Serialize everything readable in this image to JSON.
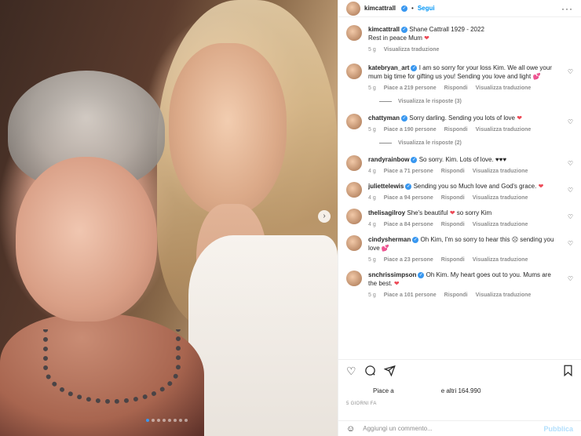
{
  "header": {
    "username": "kimcattrall",
    "separator": "•",
    "follow_label": "Segui",
    "more_icon": "more-horizontal-icon"
  },
  "caption": {
    "username": "kimcattrall",
    "text": "Shane Cattrall 1929 - 2022",
    "text2": "Rest in peace Mum",
    "emoji": "❤",
    "age": "5 g",
    "translate": "Visualizza traduzione"
  },
  "comments": [
    {
      "username": "katebryan_art",
      "verified": true,
      "text": "I am so sorry for your loss Kim. We all owe your mum big time for gifting us you! Sending you love and light",
      "emoji": "💕",
      "emoji_class": "pink",
      "age": "5 g",
      "likes": "Piace a 219 persone",
      "reply": "Rispondi",
      "translate": "Visualizza traduzione",
      "replies": "Visualizza le risposte (3)"
    },
    {
      "username": "chattyman",
      "verified": true,
      "text": "Sorry darling. Sending you lots of love",
      "emoji": "❤",
      "emoji_class": "red",
      "age": "5 g",
      "likes": "Piace a 190 persone",
      "reply": "Rispondi",
      "translate": "Visualizza traduzione",
      "replies": "Visualizza le risposte (2)"
    },
    {
      "username": "randyrainbow",
      "verified": true,
      "text": "So sorry. Kim. Lots of love.",
      "emoji": "♥♥♥",
      "emoji_class": "",
      "age": "4 g",
      "likes": "Piace a 71 persone",
      "reply": "Rispondi",
      "translate": "Visualizza traduzione",
      "replies": ""
    },
    {
      "username": "juliettelewis",
      "verified": true,
      "text": "Sending you so Much love and God's grace.",
      "emoji": "❤",
      "emoji_class": "red",
      "age": "4 g",
      "likes": "Piace a 94 persone",
      "reply": "Rispondi",
      "translate": "Visualizza traduzione",
      "replies": ""
    },
    {
      "username": "thelisagilroy",
      "verified": false,
      "text": "She's beautiful",
      "emoji": "❤",
      "emoji_class": "red",
      "text_after": "so sorry Kim",
      "age": "4 g",
      "likes": "Piace a 84 persone",
      "reply": "Rispondi",
      "translate": "Visualizza traduzione",
      "replies": ""
    },
    {
      "username": "cindysherman",
      "verified": true,
      "text": "Oh Kim, I'm so sorry to hear this ☹ sending you love",
      "emoji": "💕",
      "emoji_class": "pink",
      "age": "5 g",
      "likes": "Piace a 23 persone",
      "reply": "Rispondi",
      "translate": "Visualizza traduzione",
      "replies": ""
    },
    {
      "username": "snchrissimpson",
      "verified": true,
      "text": "Oh Kim. My heart goes out to you. Mums are the best.",
      "emoji": "❤",
      "emoji_class": "red",
      "age": "5 g",
      "likes": "Piace a 101 persone",
      "reply": "Rispondi",
      "translate": "Visualizza traduzione",
      "replies": ""
    }
  ],
  "actions": {
    "like_icon": "heart-outline-icon",
    "comment_icon": "comment-icon",
    "share_icon": "share-icon",
    "save_icon": "bookmark-icon"
  },
  "likes": {
    "prefix": "Piace a",
    "suffix": "e altri 164.990"
  },
  "post_age": "5 GIORNI FA",
  "add_comment": {
    "placeholder": "Aggiungi un commento...",
    "publish_label": "Pubblica",
    "emoji_icon": "smiley-icon"
  },
  "carousel": {
    "next_icon": "chevron-right-icon",
    "slide_count": 8,
    "active_index": 0
  },
  "colors": {
    "follow": "#0095f6",
    "verified": "#3897f0",
    "heart": "#ed4956",
    "publish_disabled": "#b2dffc"
  }
}
